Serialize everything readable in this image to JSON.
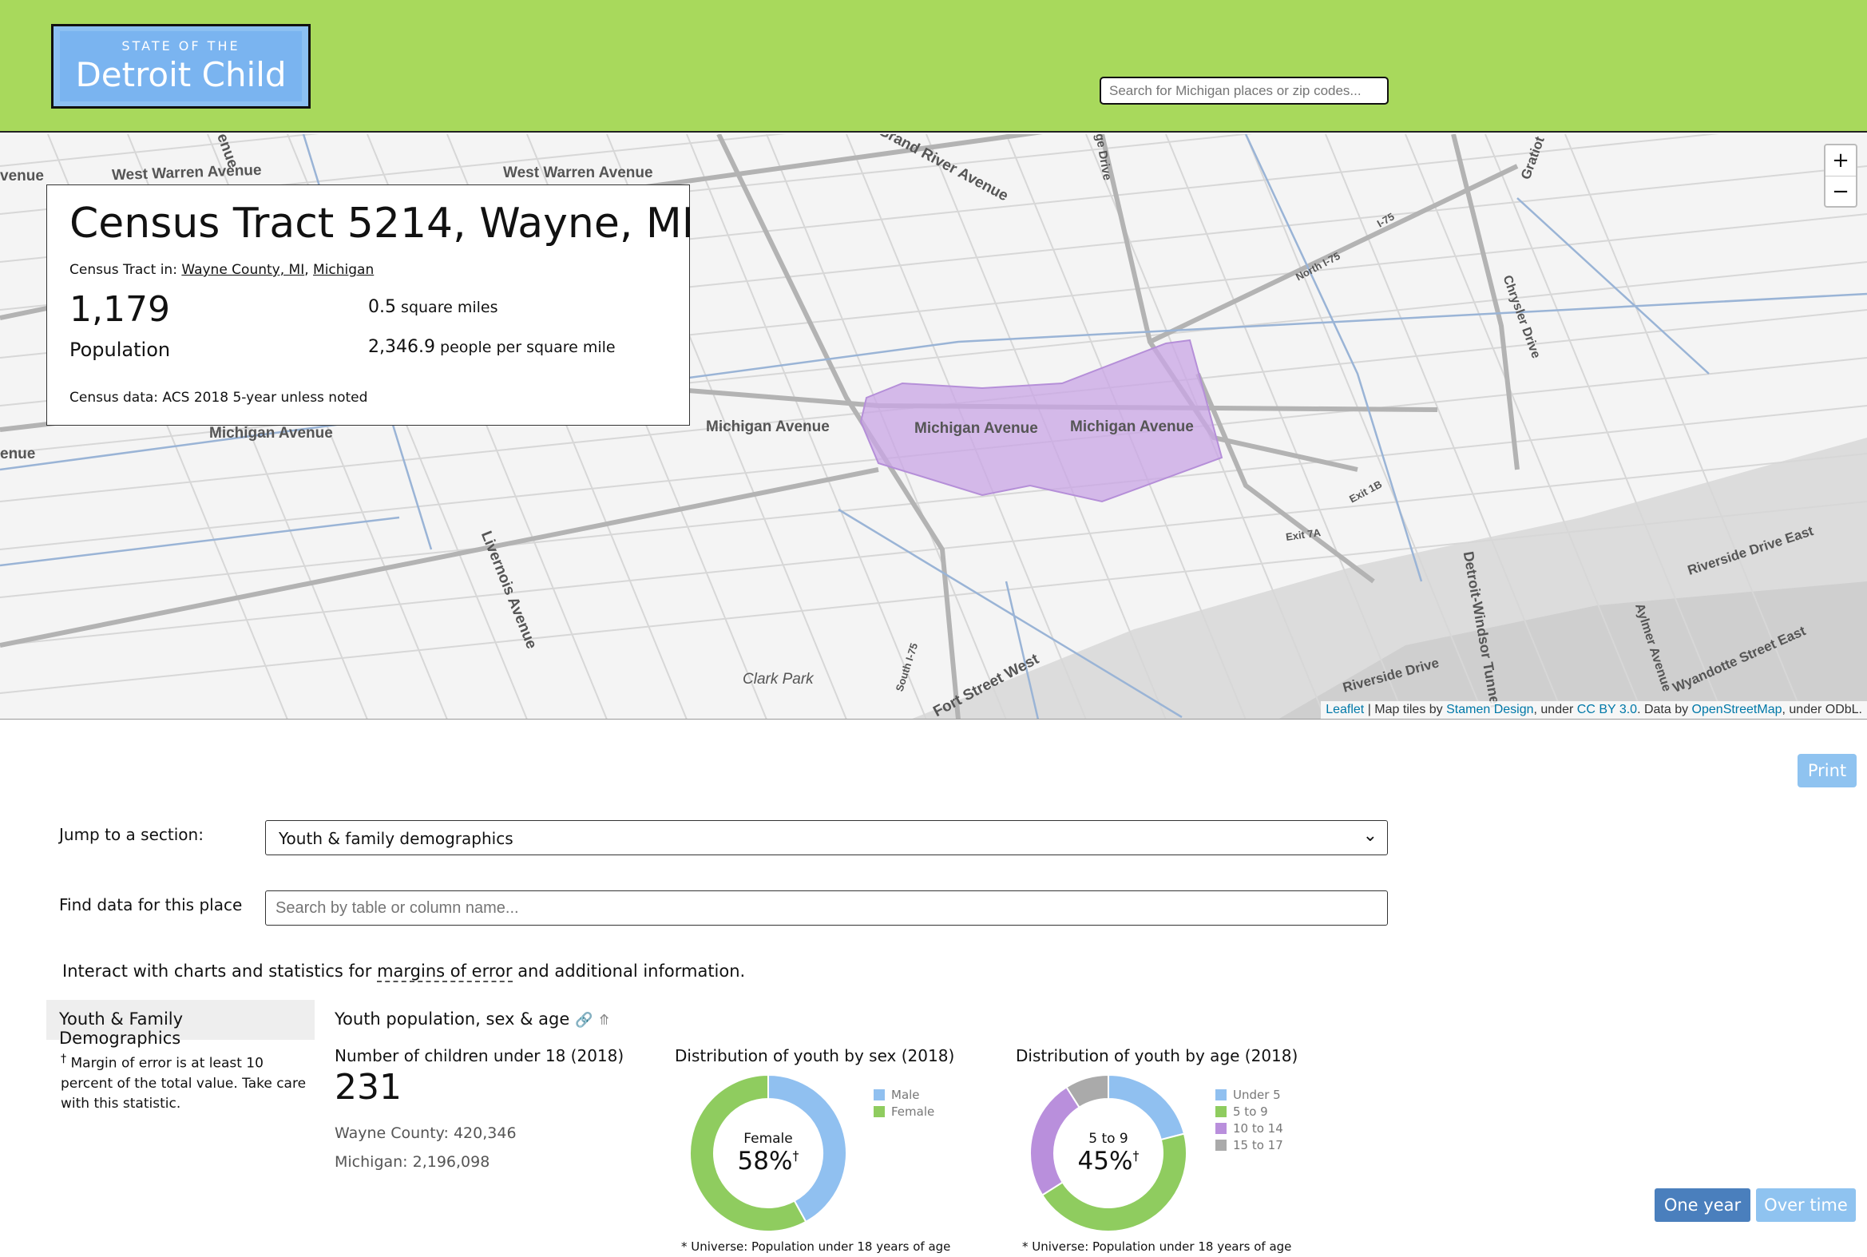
{
  "header": {
    "logo_small": "STATE OF THE",
    "logo_big": "Detroit Child",
    "search_placeholder": "Search for Michigan places or zip codes..."
  },
  "map": {
    "zoom_in": "+",
    "zoom_out": "−",
    "attribution": {
      "leaflet": "Leaflet",
      "sep1": " | Map tiles by ",
      "stamen": "Stamen Design",
      "sep2": ", under ",
      "cc": "CC BY 3.0",
      "sep3": ". Data by ",
      "osm": "OpenStreetMap",
      "sep4": ", under ODbL."
    },
    "labels": {
      "w_warren_1": "West Warren Avenue",
      "w_warren_2": "West Warren Avenue",
      "michigan_1": "Michigan Avenue",
      "michigan_2": "Michigan Avenue",
      "michigan_3": "Michigan Avenue",
      "michigan_4": "Michigan Avenue",
      "clark_park": "Clark Park",
      "fort_street": "Fort Street West",
      "riverside": "Riverside Drive",
      "riverside_east": "Riverside Drive East",
      "wyandotte": "Wyandotte Street East",
      "tunnel": "Detroit-Windsor Tunnel",
      "livernois": "Livernois Avenue",
      "grand_river": "Grand River Avenue",
      "chrysler": "Chrysler Drive",
      "aylmer": "Aylmer Avenue",
      "gratiot": "Gratiot",
      "north75": "North I-75",
      "exit18": "Exit 1B",
      "exit7a": "Exit 7A",
      "venue1": "venue",
      "venue2": "enue",
      "enue_top": "enue",
      "south75": "South I-75",
      "ge_drive": "ge Drive",
      "i75": "I-75"
    },
    "highlight_color": "#c9a6e6"
  },
  "card": {
    "title": "Census Tract 5214, Wayne, MI",
    "parents_prefix": "Census Tract in: ",
    "parent_county": "Wayne County, MI",
    "parent_sep": ", ",
    "parent_state": "Michigan",
    "population_value": "1,179",
    "population_label": "Population",
    "area_value": "0.5",
    "area_label": "square miles",
    "density_value": "2,346.9",
    "density_label": "people per square mile",
    "census_note": "Census data:  ACS 2018 5-year unless noted"
  },
  "controls": {
    "print_label": "Print",
    "jump_label": "Jump to a section:",
    "jump_value": "Youth & family demographics",
    "find_label": "Find data for this place",
    "find_placeholder": "Search by table or column name...",
    "interact_prefix": "Interact with charts and statistics for ",
    "interact_link": "margins of error",
    "interact_suffix": " and additional information."
  },
  "section": {
    "tab_label": "Youth & Family Demographics",
    "moe_note": "Margin of error is at least 10 percent of the total value. Take care with this statistic.",
    "moe_mark": "†",
    "subtitle": "Youth population, sex & age",
    "children": {
      "title": "Number of children under 18 (2018)",
      "value": "231",
      "county": "Wayne County: 420,346",
      "state": "Michigan: 2,196,098"
    },
    "by_sex": {
      "title": "Distribution of youth by sex (2018)",
      "center_label": "Female",
      "center_value": "58%",
      "universe": "* Universe: Population under 18 years of age"
    },
    "by_age": {
      "title": "Distribution of youth by age (2018)",
      "center_label": "5 to 9",
      "center_value": "45%",
      "universe": "* Universe: Population under 18 years of age"
    },
    "one_year": "One year",
    "over_time": "Over time"
  },
  "chart_data": [
    {
      "type": "pie",
      "title": "Distribution of youth by sex (2018)",
      "categories": [
        "Male",
        "Female"
      ],
      "values": [
        42,
        58
      ],
      "colors": [
        "#90c0f0",
        "#8fcc5f"
      ],
      "legend": "right"
    },
    {
      "type": "pie",
      "title": "Distribution of youth by age (2018)",
      "categories": [
        "Under 5",
        "5 to 9",
        "10 to 14",
        "15 to 17"
      ],
      "values": [
        21,
        45,
        25,
        9
      ],
      "colors": [
        "#90c0f0",
        "#8fcc5f",
        "#b98fdc",
        "#aaaaaa"
      ],
      "legend": "right"
    }
  ]
}
